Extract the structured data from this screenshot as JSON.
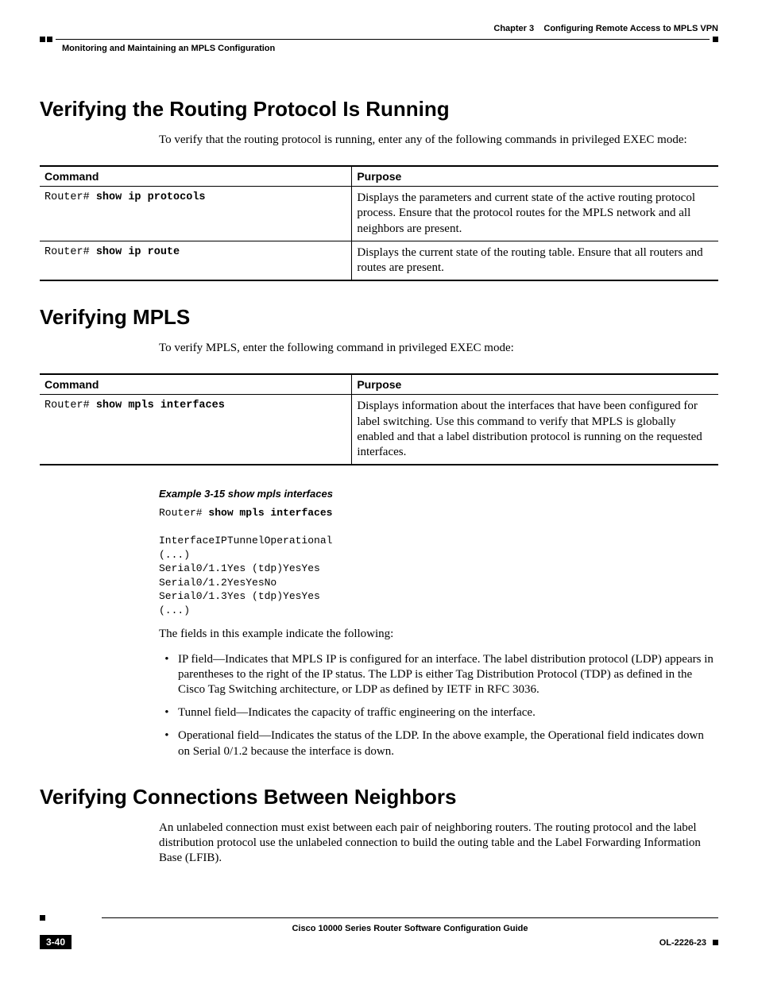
{
  "header": {
    "chapter_label": "Chapter 3",
    "chapter_title": "Configuring Remote Access to MPLS VPN",
    "breadcrumb": "Monitoring and Maintaining an MPLS Configuration"
  },
  "sections": {
    "s1": {
      "title": "Verifying the Routing Protocol Is Running",
      "intro": "To verify that the routing protocol is running, enter any of the following commands in privileged EXEC mode:"
    },
    "s2": {
      "title": "Verifying MPLS",
      "intro": "To verify MPLS, enter the following command in privileged EXEC mode:",
      "example_label": "Example 3-15   show mpls interfaces",
      "example_prompt": "Router# ",
      "example_cmd": "show mpls interfaces",
      "example_output": "InterfaceIPTunnelOperational\n(...)\nSerial0/1.1Yes (tdp)YesYes\nSerial0/1.2YesYesNo\nSerial0/1.3Yes (tdp)YesYes\n(...)",
      "post_example": "The fields in this example indicate the following:",
      "bullets": [
        "IP field—Indicates that MPLS IP is configured for an interface. The label distribution protocol (LDP) appears in parentheses to the right of the IP status. The LDP is either Tag Distribution Protocol (TDP) as defined in the Cisco Tag Switching architecture, or LDP as defined by IETF in RFC 3036.",
        "Tunnel field—Indicates the capacity of traffic engineering on the interface.",
        "Operational field—Indicates the status of the LDP. In the above example, the Operational field indicates down on Serial 0/1.2 because the interface is down."
      ]
    },
    "s3": {
      "title": "Verifying Connections Between Neighbors",
      "intro": "An unlabeled connection must exist between each pair of neighboring routers. The routing protocol and the label distribution protocol use the unlabeled connection to build the outing table and the Label Forwarding Information Base (LFIB)."
    }
  },
  "tables": {
    "t1": {
      "headers": {
        "c1": "Command",
        "c2": "Purpose"
      },
      "rows": [
        {
          "prompt": "Router# ",
          "cmd": "show ip protocols",
          "purpose": "Displays the parameters and current state of the active routing protocol process. Ensure that the protocol routes for the MPLS network and all neighbors are present."
        },
        {
          "prompt": "Router# ",
          "cmd": "show ip route",
          "purpose": "Displays the current state of the routing table. Ensure that all routers and routes are present."
        }
      ]
    },
    "t2": {
      "headers": {
        "c1": "Command",
        "c2": "Purpose"
      },
      "rows": [
        {
          "prompt": "Router# ",
          "cmd": "show mpls interfaces",
          "purpose": "Displays information about the interfaces that have been configured for label switching. Use this command to verify that MPLS is globally enabled and that a label distribution protocol is running on the requested interfaces."
        }
      ]
    }
  },
  "footer": {
    "guide_title": "Cisco 10000 Series Router Software Configuration Guide",
    "page_number": "3-40",
    "doc_id": "OL-2226-23"
  }
}
